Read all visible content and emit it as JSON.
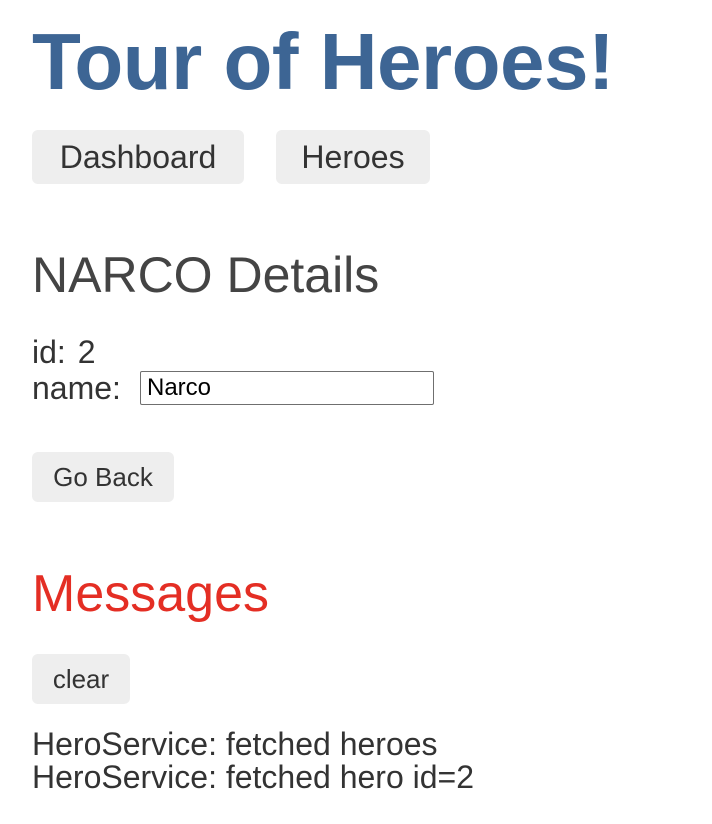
{
  "app": {
    "title": "Tour of Heroes!"
  },
  "nav": {
    "dashboard_label": "Dashboard",
    "heroes_label": "Heroes"
  },
  "hero_detail": {
    "title": "NARCO Details",
    "id_label": "id:",
    "id_value": "2",
    "name_label": "name:",
    "name_value": "Narco",
    "back_label": "Go Back"
  },
  "messages": {
    "title": "Messages",
    "clear_label": "clear",
    "items": [
      "HeroService: fetched heroes",
      "HeroService: fetched hero id=2"
    ]
  },
  "colors": {
    "title": "#3d6594",
    "messages_title": "#e42e24",
    "button_bg": "#eeeeee",
    "text": "#333333"
  }
}
